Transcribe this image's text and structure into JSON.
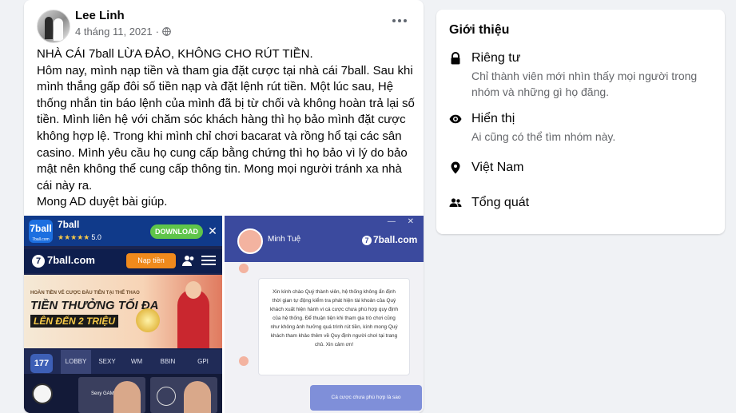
{
  "post": {
    "author": "Lee Linh",
    "date": "4 tháng 11, 2021",
    "text": "NHÀ CÁI 7ball LỪA ĐẢO, KHÔNG CHO RÚT TIỀN.\nHôm nay, mình nạp tiền và tham gia đặt cược tại nhà cái 7ball. Sau khi mình thắng gấp đôi số tiền nạp và đặt lệnh rút tiền. Một lúc sau, Hệ thống nhắn tin báo lệnh của mình đã bị từ chối và không hoàn trả lại số tiền. Mình liên hệ với chăm sóc khách hàng thì họ bảo mình đặt cược không hợp lệ. Trong khi mình chỉ chơi bacarat và rồng hổ tại các sân casino. Mình yêu cầu họ cung cấp bằng chứng thì họ bảo vì lý do bảo mật nên không thể cung cấp thông tin. Mong mọi người tránh xa nhà cái này ra.\nMong AD duyệt bài giúp."
  },
  "screenshot_left": {
    "app_logo": "7ball",
    "app_logo_sub": "7ball.com",
    "app_name": "7ball",
    "rating_stars": "★★★★★",
    "rating_value": "5.0",
    "download_label": "DOWNLOAD",
    "close_glyph": "✕",
    "site_logo": "7ball.com",
    "site_logo_mark": "7",
    "deposit_label": "Nạp tiền",
    "promo_small": "HOÀN TIỀN VÉ CƯỢC ĐẦU TIÊN TẠI THỂ THAO",
    "promo_big": "TIỀN THƯỞNG TỐI ĐA",
    "promo_amount": "LÊN ĐẾN 2 TRIỆU",
    "cat_badge": "177",
    "tabs": [
      "LOBBY",
      "SEXY",
      "WM",
      "BBIN",
      "GPI"
    ],
    "card_label": "Sexy GAMING"
  },
  "screenshot_right": {
    "window_controls": "— ✕",
    "agent_name": "Minh Tuệ",
    "brand": "7ball.com",
    "brand_mark": "7",
    "message": "Xin kính chào Quý thành viên, hệ thống không ẩn định thời gian tự động kiểm tra phát hiện tài khoản của Quý khách xuất hiện hành vi cá cược chưa phù hợp quy định của hệ thống. Để thuận tiện khi tham gia trò chơi cũng như không ảnh hưởng quá trình rút tiền, kính mong Quý khách tham khảo thêm về Quy định người chơi tại trang chủ. Xin cảm ơn!",
    "reply": "Cá cược chưa phù hợp là sao"
  },
  "intro": {
    "title": "Giới thiệu",
    "privacy_title": "Riêng tư",
    "privacy_desc": "Chỉ thành viên mới nhìn thấy mọi người trong nhóm và những gì họ đăng.",
    "visible_title": "Hiển thị",
    "visible_desc": "Ai cũng có thể tìm nhóm này.",
    "location": "Việt Nam",
    "general": "Tổng quát"
  },
  "colors": {
    "card_bg": "#ffffff",
    "page_bg": "#f0f2f5",
    "secondary_text": "#65676b",
    "chat_header": "#3b4a9e"
  },
  "icons": [
    "avatar",
    "globe-icon",
    "more-icon",
    "lock-icon",
    "eye-icon",
    "location-pin-icon",
    "group-icon"
  ]
}
